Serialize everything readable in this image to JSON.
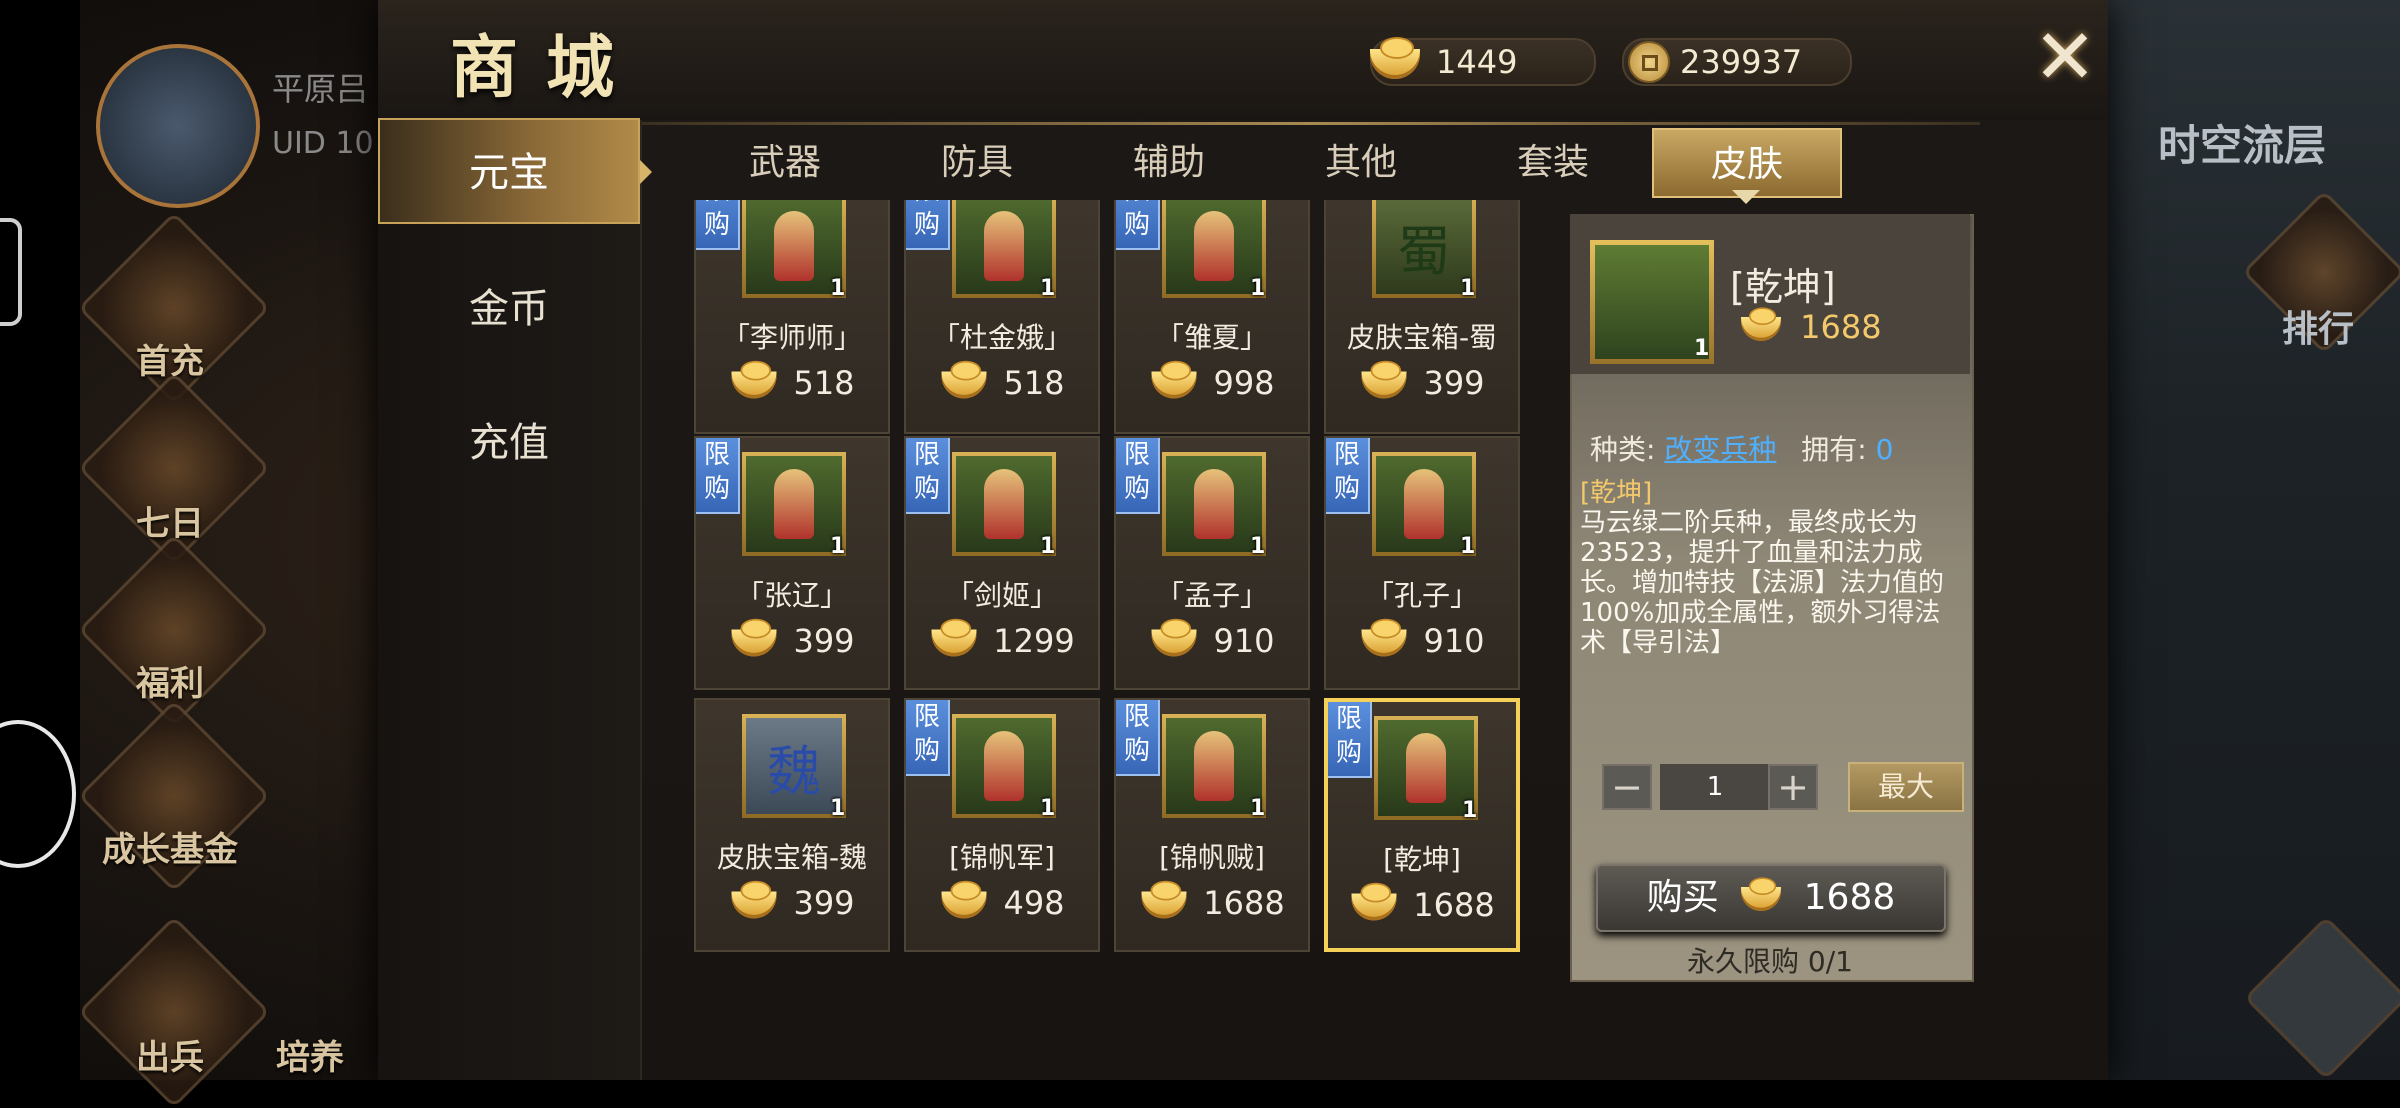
{
  "header": {
    "title": "商城",
    "ingot_balance": "1449",
    "coin_balance": "239937"
  },
  "background": {
    "player_name": "平原吕",
    "uid": "UID 10",
    "right_title": "时空流层",
    "right_rank": "排行",
    "left_menu": [
      "首充",
      "七日",
      "福利",
      "成长基金",
      "出兵",
      "培养"
    ]
  },
  "nav": [
    "元宝",
    "金币",
    "充值"
  ],
  "tabs": [
    "武器",
    "防具",
    "辅助",
    "其他",
    "套装",
    "皮肤"
  ],
  "limit_badge": "限购",
  "items": [
    {
      "name": "「李师师」",
      "price": "518",
      "qty": "1",
      "limited": true,
      "icon": "woman-yellow-dress-icon"
    },
    {
      "name": "「杜金娥」",
      "price": "518",
      "qty": "1",
      "limited": true,
      "icon": "warrior-woman-red-icon"
    },
    {
      "name": "「雏夏」",
      "price": "998",
      "qty": "1",
      "limited": true,
      "icon": "woman-white-robe-icon"
    },
    {
      "name": "皮肤宝箱-蜀",
      "price": "399",
      "qty": "1",
      "limited": false,
      "glyph": "蜀",
      "icon": "shu-chest-icon"
    },
    {
      "name": "「张辽」",
      "price": "399",
      "qty": "1",
      "limited": true,
      "icon": "cavalry-general-icon"
    },
    {
      "name": "「剑姬」",
      "price": "1299",
      "qty": "1",
      "limited": true,
      "icon": "swordswoman-icon"
    },
    {
      "name": "「孟子」",
      "price": "910",
      "qty": "1",
      "limited": true,
      "icon": "scholar-blue-icon"
    },
    {
      "name": "「孔子」",
      "price": "910",
      "qty": "1",
      "limited": true,
      "icon": "sage-grey-icon"
    },
    {
      "name": "皮肤宝箱-魏",
      "price": "399",
      "qty": "1",
      "limited": false,
      "glyph": "魏",
      "icon": "wei-chest-icon"
    },
    {
      "name": "[锦帆军]",
      "price": "498",
      "qty": "1",
      "limited": true,
      "icon": "pirate-soldier-icon"
    },
    {
      "name": "[锦帆贼]",
      "price": "1688",
      "qty": "1",
      "limited": true,
      "icon": "pirate-bandit-icon"
    },
    {
      "name": "[乾坤]",
      "price": "1688",
      "qty": "1",
      "limited": true,
      "icon": "qiankun-strategist-icon"
    }
  ],
  "detail": {
    "name": "[乾坤]",
    "price": "1688",
    "qty_badge": "1",
    "type_label": "种类:",
    "type_value": "改变兵种",
    "own_label": "拥有:",
    "own_value": "0",
    "desc_title": "[乾坤]",
    "desc": "马云绿二阶兵种，最终成长为23523，提升了血量和法力成长。增加特技【法源】法力值的100%加成全属性，额外习得法术【导引法】",
    "quantity": "1",
    "minus": "−",
    "plus": "+",
    "max_label": "最大",
    "buy_label": "购买",
    "buy_price": "1688",
    "limit_text": "永久限购 0/1"
  },
  "colors": {
    "accent_gold": "#c9a25a",
    "limit_blue": "#3f72c4",
    "type_blue": "#4fb0ff",
    "price_gold": "#f3c96b"
  }
}
